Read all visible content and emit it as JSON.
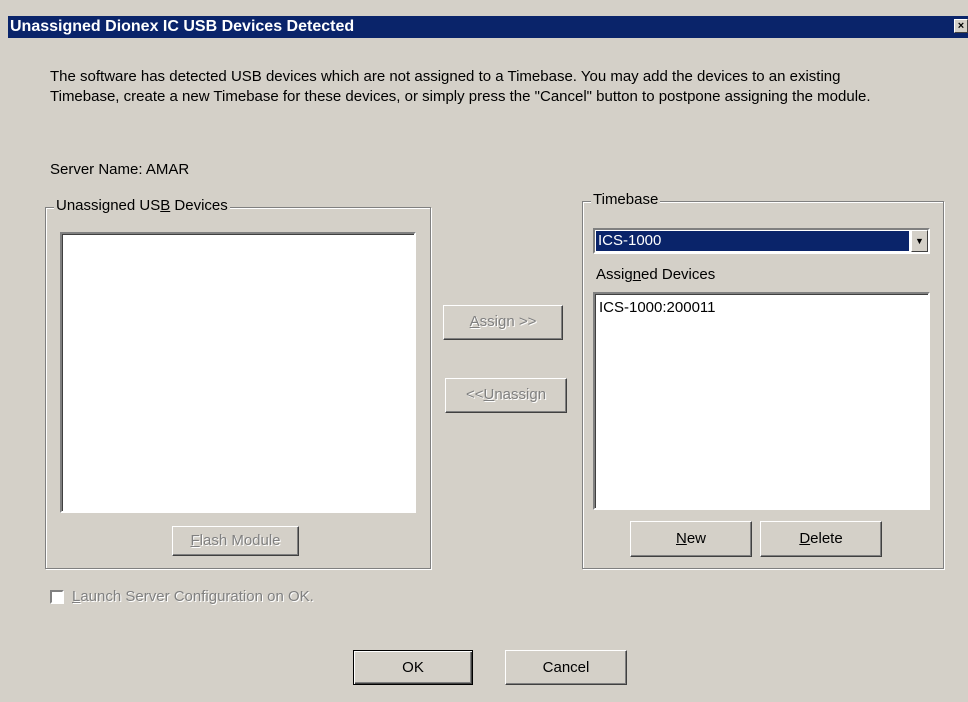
{
  "dialog": {
    "title": "Unassigned Dionex IC USB Devices Detected",
    "close_glyph": "×",
    "intro_text": "The software has detected USB devices which are not assigned to a Timebase. You may add the devices to an existing Timebase, create a new Timebase for these devices, or simply press the \"Cancel\" button to postpone assigning the module.",
    "server_label": "Server Name:",
    "server_name": "AMAR"
  },
  "unassigned": {
    "group_label_pre": "Unassigned US",
    "group_label_key": "B",
    "group_label_post": " Devices",
    "items": [],
    "flash_pre": "",
    "flash_key": "F",
    "flash_post": "lash Module"
  },
  "middle": {
    "assign_key": "A",
    "assign_post": "ssign >>",
    "unassign_pre": "<< ",
    "unassign_key": "U",
    "unassign_post": "nassign"
  },
  "timebase": {
    "group_label": "Timebase",
    "selected": "ICS-1000",
    "assigned_pre": "Assig",
    "assigned_key": "n",
    "assigned_post": "ed Devices",
    "assigned_items": [
      "ICS-1000:200011"
    ],
    "new_key": "N",
    "new_post": "ew",
    "delete_key": "D",
    "delete_post": "elete"
  },
  "footer": {
    "launch_key": "L",
    "launch_post": "aunch Server Configuration on OK.",
    "launch_checked": false,
    "ok_label": "OK",
    "cancel_label": "Cancel"
  },
  "icons": {
    "close": "close-icon",
    "dropdown": "chevron-down-icon",
    "dropdown_glyph": "▼"
  }
}
